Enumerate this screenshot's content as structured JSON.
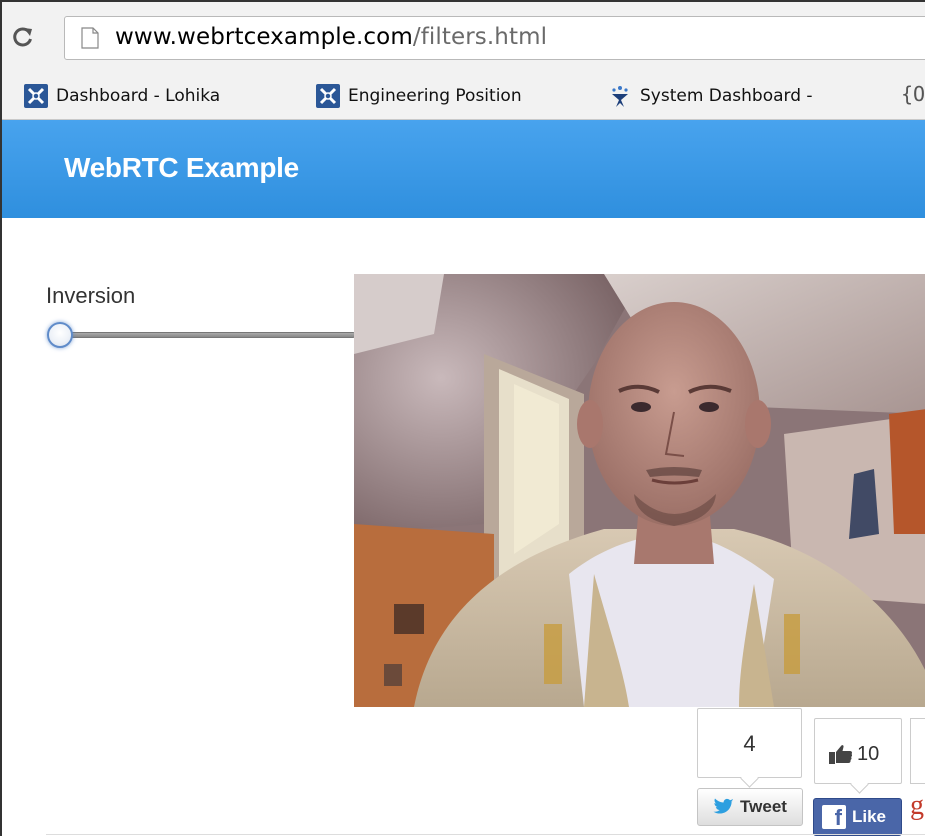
{
  "browser": {
    "url_domain": "www.webrtcexample.com",
    "url_path": "/filters.html",
    "bookmarks": [
      {
        "label": "Dashboard - Lohika",
        "icon": "jira-icon"
      },
      {
        "label": "Engineering Position",
        "icon": "jira-icon"
      },
      {
        "label": "System Dashboard -",
        "icon": "confluence-icon"
      }
    ],
    "bookmark_overflow": "{O"
  },
  "navbar": {
    "brand": "WebRTC Example",
    "color": "#3d9ae8"
  },
  "filter": {
    "label": "Inversion",
    "value": 0
  },
  "social": {
    "tweet_count": "4",
    "tweet_label": "Tweet",
    "like_count": "10",
    "like_label": "Like",
    "fb_color": "#4a66a8"
  }
}
